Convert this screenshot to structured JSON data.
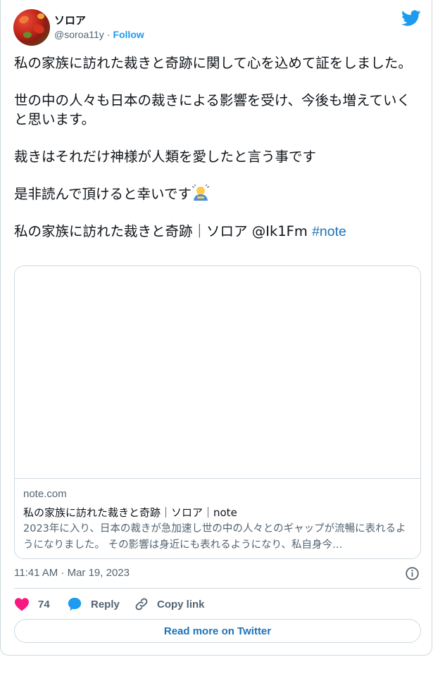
{
  "author": {
    "display_name": "ソロア",
    "handle": "@soroa11y",
    "separator": "·",
    "follow_label": "Follow"
  },
  "tweet": {
    "paragraphs": [
      "私の家族に訪れた裁きと奇跡に関して心を込めて証をしました。",
      "世の中の人々も日本の裁きによる影響を受け、今後も増えていくと思います。",
      "裁きはそれだけ神様が人類を愛したと言う事です",
      "是非読んで頂けると幸いです"
    ],
    "link_line": "私の家族に訪れた裁きと奇跡｜ソロア @Ik1Fm",
    "hashtag": "#note",
    "emoji": "man-bowing-emoji"
  },
  "card": {
    "domain": "note.com",
    "title": "私の家族に訪れた裁きと奇跡｜ソロア｜note",
    "description": "2023年に入り、日本の裁きが急加速し世の中の人々とのギャップが流暢に表れるようになりました。 その影響は身近にも表れるようになり、私自身今…"
  },
  "meta": {
    "timestamp": "11:41 AM · Mar 19, 2023"
  },
  "actions": {
    "like_count": "74",
    "reply_label": "Reply",
    "copy_label": "Copy link",
    "read_more_label": "Read more on Twitter"
  },
  "colors": {
    "accent": "#1d9bf0",
    "link": "#1d72b8",
    "like": "#f91880",
    "muted": "#536471",
    "border": "#cfd9de"
  },
  "icons": [
    "twitter-bird-icon",
    "info-icon",
    "heart-icon",
    "reply-bubble-icon",
    "link-icon"
  ]
}
